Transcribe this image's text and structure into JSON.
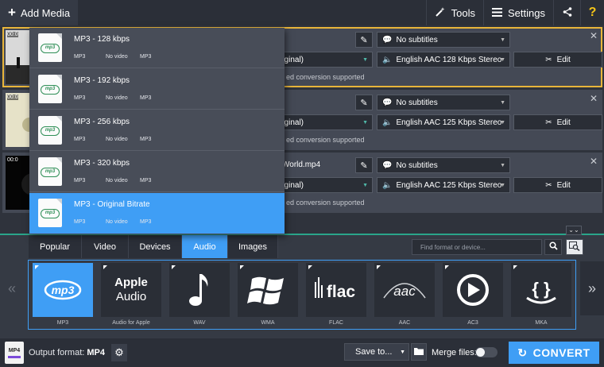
{
  "toolbar": {
    "add_media": "Add Media",
    "tools": "Tools",
    "settings": "Settings",
    "help": "?"
  },
  "files": [
    {
      "time": "00:0",
      "name_fragment": "",
      "subtitles": "No subtitles",
      "video_fragment": "riginal)",
      "audio": "English AAC 128 Kbps Stereo",
      "edit": "Edit",
      "note": "ed conversion supported",
      "selected": true
    },
    {
      "time": "00:0",
      "name_fragment": "",
      "subtitles": "No subtitles",
      "video_fragment": "riginal)",
      "audio": "English AAC 125 Kbps Stereo",
      "edit": "Edit",
      "note": "ed conversion supported",
      "selected": false
    },
    {
      "time": "00:0",
      "name_fragment": "World.mp4",
      "subtitles": "No subtitles",
      "video_fragment": "riginal)",
      "audio": "English AAC 125 Kbps Stereo",
      "edit": "Edit",
      "note": "ed conversion supported",
      "selected": false
    }
  ],
  "presets": [
    {
      "title": "MP3 - 128 kbps",
      "col1": "MP3",
      "col2": "No video",
      "col3": "MP3",
      "active": false
    },
    {
      "title": "MP3 - 192 kbps",
      "col1": "MP3",
      "col2": "No video",
      "col3": "MP3",
      "active": false
    },
    {
      "title": "MP3 - 256 kbps",
      "col1": "MP3",
      "col2": "No video",
      "col3": "MP3",
      "active": false
    },
    {
      "title": "MP3 - 320 kbps",
      "col1": "MP3",
      "col2": "No video",
      "col3": "MP3",
      "active": false
    },
    {
      "title": "MP3 - Original Bitrate",
      "col1": "MP3",
      "col2": "No video",
      "col3": "MP3",
      "active": true
    }
  ],
  "preset_icon_text": "mp3",
  "tabs": [
    {
      "label": "Popular",
      "active": false
    },
    {
      "label": "Video",
      "active": false
    },
    {
      "label": "Devices",
      "active": false
    },
    {
      "label": "Audio",
      "active": true
    },
    {
      "label": "Images",
      "active": false
    }
  ],
  "format_search": {
    "placeholder": "Find format or device..."
  },
  "formats": [
    {
      "label": "MP3",
      "icon": "mp3-icon",
      "text": "mp3",
      "active": true
    },
    {
      "label": "Audio for Apple",
      "icon": "apple-audio-icon",
      "text": "Apple",
      "text2": "Audio",
      "active": false
    },
    {
      "label": "WAV",
      "icon": "music-note-icon",
      "active": false
    },
    {
      "label": "WMA",
      "icon": "windows-logo-icon",
      "active": false
    },
    {
      "label": "FLAC",
      "icon": "flac-icon",
      "text": "flac",
      "active": false
    },
    {
      "label": "AAC",
      "icon": "aac-icon",
      "text": "aac",
      "active": false
    },
    {
      "label": "AC3",
      "icon": "ac3-play-icon",
      "active": false
    },
    {
      "label": "MKA",
      "icon": "mka-icon",
      "text": "{ }",
      "active": false
    }
  ],
  "bottom": {
    "output_icon_text": "MP4",
    "output_label": "Output format:",
    "output_value": "MP4",
    "save_to": "Save to...",
    "merge_label": "Merge files:",
    "merge_on": false,
    "convert": "CONVERT"
  },
  "colors": {
    "accent": "#3f9ef5",
    "selection_border": "#e8b53a",
    "splitter": "#2aa58a",
    "mp3_green": "#2f8f57"
  }
}
